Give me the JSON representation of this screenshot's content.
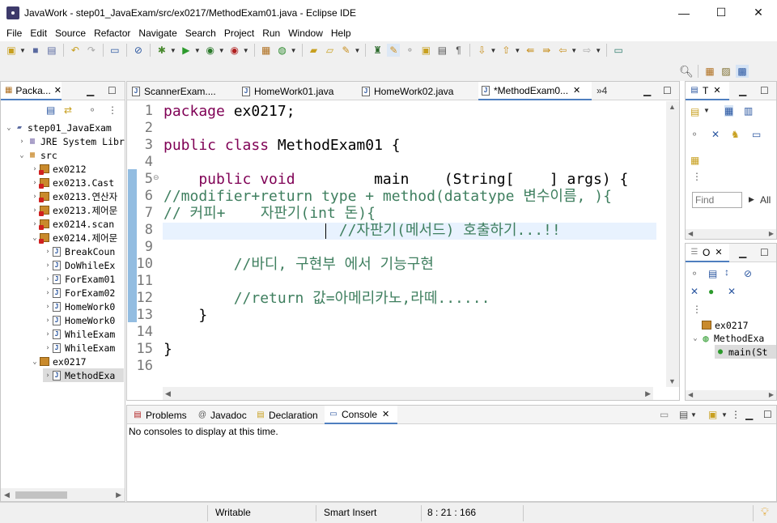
{
  "window": {
    "title": "JavaWork - step01_JavaExam/src/ex0217/MethodExam01.java - Eclipse IDE",
    "minimize": "—",
    "maximize": "☐",
    "close": "✕"
  },
  "menu": [
    "File",
    "Edit",
    "Source",
    "Refactor",
    "Navigate",
    "Search",
    "Project",
    "Run",
    "Window",
    "Help"
  ],
  "package_explorer": {
    "tab_label": "Packa...",
    "tree": [
      {
        "label": "step01_JavaExam",
        "icon": "project-icon"
      },
      {
        "label": "JRE System Libr",
        "icon": "library-icon"
      },
      {
        "label": "src",
        "icon": "source-folder-icon"
      },
      {
        "label": "ex0212",
        "icon": "package-icon"
      },
      {
        "label": "ex0213.Cast",
        "icon": "package-icon"
      },
      {
        "label": "ex0213.연산자",
        "icon": "package-icon"
      },
      {
        "label": "ex0213.제어문",
        "icon": "package-icon"
      },
      {
        "label": "ex0214.scan",
        "icon": "package-icon"
      },
      {
        "label": "ex0214.제어문",
        "icon": "package-icon"
      },
      {
        "label": "BreakCoun",
        "icon": "java-file-icon"
      },
      {
        "label": "DoWhileEx",
        "icon": "java-file-icon"
      },
      {
        "label": "ForExam01",
        "icon": "java-file-icon"
      },
      {
        "label": "ForExam02",
        "icon": "java-file-icon"
      },
      {
        "label": "HomeWork0",
        "icon": "java-file-icon"
      },
      {
        "label": "HomeWork0",
        "icon": "java-file-icon"
      },
      {
        "label": "WhileExam",
        "icon": "java-file-icon"
      },
      {
        "label": "WhileExam",
        "icon": "java-file-icon"
      },
      {
        "label": "ex0217",
        "icon": "package-icon"
      },
      {
        "label": "MethodExa",
        "icon": "java-file-icon"
      }
    ]
  },
  "editor": {
    "tabs": [
      {
        "label": "ScannerExam...."
      },
      {
        "label": "HomeWork01.java"
      },
      {
        "label": "HomeWork02.java"
      },
      {
        "label": "*MethodExam0..."
      }
    ],
    "overflow_count": "»4",
    "lines": [
      {
        "num": "1",
        "segments": [
          {
            "t": "package",
            "c": "kw"
          },
          {
            "t": " ex0217;",
            "c": ""
          }
        ]
      },
      {
        "num": "2",
        "segments": []
      },
      {
        "num": "3",
        "segments": [
          {
            "t": "public class",
            "c": "kw"
          },
          {
            "t": " MethodExam01 {",
            "c": ""
          }
        ]
      },
      {
        "num": "4",
        "segments": []
      },
      {
        "num": "5",
        "segments": [
          {
            "t": "    public void",
            "c": "kw"
          },
          {
            "t": "         main    (String[    ] args) {",
            "c": ""
          }
        ]
      },
      {
        "num": "6",
        "segments": [
          {
            "t": "//modifier+return type + method(datatype 변수이름, ){",
            "c": "cm"
          }
        ]
      },
      {
        "num": "7",
        "segments": [
          {
            "t": "// 커피+    자판기(int 돈){",
            "c": "cm"
          }
        ]
      },
      {
        "num": "8",
        "segments": [
          {
            "t": "                    //자판기(메서드) 호출하기...!!",
            "c": "cm"
          }
        ]
      },
      {
        "num": "9",
        "segments": []
      },
      {
        "num": "10",
        "segments": [
          {
            "t": "        //바디, 구현부 에서 기능구현",
            "c": "cm"
          }
        ]
      },
      {
        "num": "11",
        "segments": []
      },
      {
        "num": "12",
        "segments": [
          {
            "t": "        //return 값=아메리카노,라떼......",
            "c": "cm"
          }
        ]
      },
      {
        "num": "13",
        "segments": [
          {
            "t": "    }",
            "c": ""
          }
        ]
      },
      {
        "num": "14",
        "segments": []
      },
      {
        "num": "15",
        "segments": [
          {
            "t": "}",
            "c": ""
          }
        ]
      },
      {
        "num": "16",
        "segments": []
      }
    ]
  },
  "right_top": {
    "tab_label": "T",
    "find_placeholder": "Find",
    "all_label": "All"
  },
  "right_bottom": {
    "tab_label": "O",
    "tree": [
      {
        "label": "ex0217"
      },
      {
        "label": "MethodExa"
      },
      {
        "label": "main(St"
      }
    ]
  },
  "console": {
    "tabs": [
      "Problems",
      "Javadoc",
      "Declaration",
      "Console"
    ],
    "message": "No consoles to display at this time."
  },
  "status": {
    "writable": "Writable",
    "insert_mode": "Smart Insert",
    "position": "8 : 21 : 166"
  },
  "colors": {
    "keyword": "#7f0055",
    "comment": "#3f7f5f",
    "current_line": "#e8f2fe",
    "active_tab_underline": "#4f7fbf"
  }
}
